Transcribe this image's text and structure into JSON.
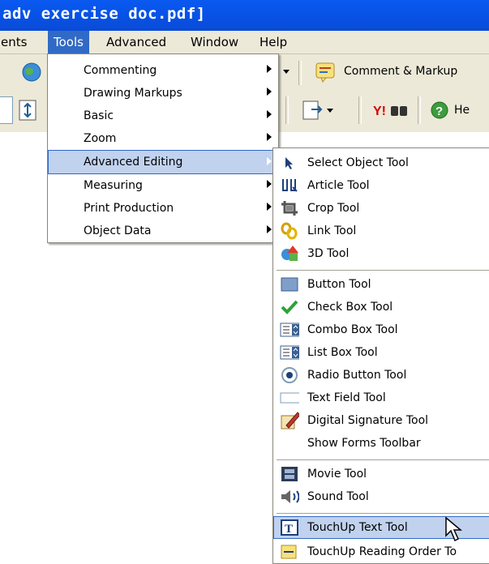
{
  "window": {
    "title": "adv exercise doc.pdf]"
  },
  "menubar": {
    "items": [
      {
        "label": "ents"
      },
      {
        "label": "Tools"
      },
      {
        "label": "Advanced"
      },
      {
        "label": "Window"
      },
      {
        "label": "Help"
      }
    ]
  },
  "toolbar": {
    "comment_markup": "Comment & Markup",
    "yahoo": "Y!",
    "help": "He"
  },
  "tools_menu": {
    "items": [
      {
        "label": "Commenting",
        "has_submenu": true
      },
      {
        "label": "Drawing Markups",
        "has_submenu": true
      },
      {
        "label": "Basic",
        "has_submenu": true
      },
      {
        "label": "Zoom",
        "has_submenu": true
      },
      {
        "label": "Advanced Editing",
        "has_submenu": true,
        "selected": true
      },
      {
        "label": "Measuring",
        "has_submenu": true
      },
      {
        "label": "Print Production",
        "has_submenu": true
      },
      {
        "label": "Object Data",
        "has_submenu": true
      }
    ]
  },
  "advanced_editing_menu": {
    "items": [
      {
        "label": "Select Object Tool",
        "icon": "arrow-cursor-icon"
      },
      {
        "label": "Article Tool",
        "icon": "article-icon"
      },
      {
        "label": "Crop Tool",
        "icon": "crop-icon"
      },
      {
        "label": "Link Tool",
        "icon": "chain-link-icon"
      },
      {
        "label": "3D Tool",
        "icon": "3d-shapes-icon"
      },
      {
        "label": "Button Tool",
        "icon": "button-shape-icon"
      },
      {
        "label": "Check Box Tool",
        "icon": "checkmark-icon"
      },
      {
        "label": "Combo Box Tool",
        "icon": "combo-box-icon"
      },
      {
        "label": "List Box Tool",
        "icon": "list-box-icon"
      },
      {
        "label": "Radio Button Tool",
        "icon": "radio-button-icon"
      },
      {
        "label": "Text Field Tool",
        "icon": "text-field-icon"
      },
      {
        "label": "Digital Signature Tool",
        "icon": "pen-signature-icon"
      },
      {
        "label": "Show Forms Toolbar",
        "icon": ""
      },
      {
        "label": "Movie Tool",
        "icon": "film-strip-icon"
      },
      {
        "label": "Sound Tool",
        "icon": "speaker-icon"
      },
      {
        "label": "TouchUp Text Tool",
        "icon": "touchup-text-icon",
        "selected": true
      },
      {
        "label": "TouchUp Reading Order To",
        "icon": "reading-order-icon"
      }
    ]
  },
  "colors": {
    "title_bar": "#0a59f0",
    "menu_bg": "#ece9d8",
    "menu_highlight": "#316ac5",
    "item_highlight": "#c1d2ee"
  }
}
